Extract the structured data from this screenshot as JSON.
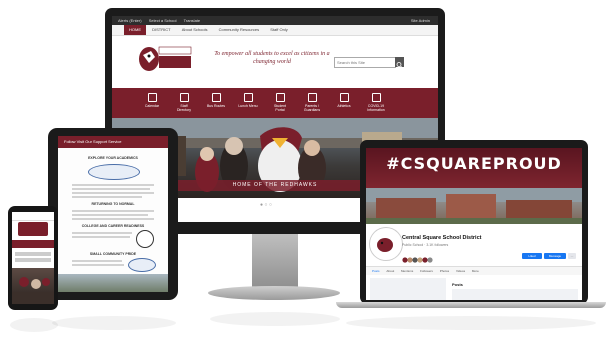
{
  "monitor": {
    "topbar": [
      "Alerts (Enter)",
      "Select a School",
      "Translate",
      "Site Admin"
    ],
    "nav": [
      "HOME",
      "DISTRICT",
      "About Schools",
      "Community Resources",
      "Staff Only"
    ],
    "logo_text": "CENTRAL SQUARE REDHAWKS",
    "slogan": "To empower all students to excel as citizens in a changing world",
    "search_placeholder": "Search this Site",
    "quick_links": [
      "Calendar",
      "Staff Directory",
      "Bus Routes",
      "Lunch Menu",
      "Student Portal",
      "Parents / Guardians",
      "Athletics",
      "COVID-19 Information"
    ],
    "hero_caption": "HOME OF THE REDHAWKS"
  },
  "tablet": {
    "banner": "Follow Visit Our Support Service",
    "headings": [
      "EXPLORE YOUR ACADEMICS",
      "RETURNING TO NORMAL",
      "COLLEGE AND CAREER READINESS",
      "SMALL COMMUNITY PRIDE"
    ]
  },
  "laptop": {
    "cover_hashtag": "#CSQUAREPROUD",
    "page_name": "Central Square School District",
    "page_sub": "Public School · 3.1K followers",
    "buttons": [
      "Liked",
      "Message"
    ],
    "tabs": [
      "Posts",
      "About",
      "Mentions",
      "Followers",
      "Photos",
      "Videos",
      "More"
    ],
    "posts_label": "Posts"
  },
  "colors": {
    "brand_maroon": "#7a1f2b",
    "device_frame": "#1b1b1b",
    "facebook_blue": "#1877f2"
  }
}
